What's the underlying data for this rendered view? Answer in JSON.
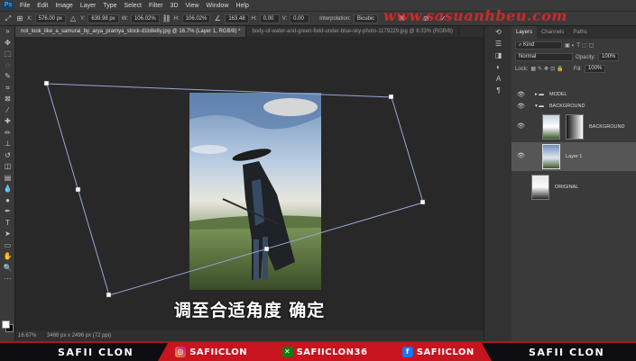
{
  "menu": {
    "logo": "Ps",
    "items": [
      "File",
      "Edit",
      "Image",
      "Layer",
      "Type",
      "Select",
      "Filter",
      "3D",
      "View",
      "Window",
      "Help"
    ]
  },
  "options": {
    "x_label": "X:",
    "x_value": "576.00 px",
    "y_label": "Y:",
    "y_value": "639.98 px",
    "w_label": "W:",
    "w_value": "106.02%",
    "h_label": "H:",
    "h_value": "106.02%",
    "angle_value": "163.48",
    "hskew_label": "H:",
    "hskew_value": "0.00",
    "vskew_label": "V:",
    "vskew_value": "0.00",
    "interp_label": "Interpolation:",
    "interp_value": "Bicubic"
  },
  "watermark": "www.sasuanhbeu.com",
  "tabs": [
    "not_look_like_a_samurai_by_arya_pramya_stock-d1b8e8y.jpg @ 16.7% (Layer 1, RGB/8) *",
    "body-of-water-and-green-field-under-blue-sky-photo-1179229.jpg @ 8.33% (RGB/8)"
  ],
  "status": {
    "zoom": "16.67%",
    "doc": "3468 px x 2496 px (72 ppi)"
  },
  "subtitle": "调至合适角度 确定",
  "panel": {
    "tabs": [
      "Layers",
      "Channels",
      "Paths"
    ],
    "blend_mode": "Normal",
    "opacity_label": "Opacity:",
    "opacity_value": "100%",
    "fill_label": "Fill:",
    "fill_value": "100%",
    "layers": [
      {
        "name": "MODEL",
        "kind": "group"
      },
      {
        "name": "BACKGROUND",
        "kind": "group"
      },
      {
        "name": "BACKGROUND",
        "kind": "layer"
      },
      {
        "name": "Layer 1",
        "kind": "layer",
        "selected": true
      },
      {
        "name": "ORIGINAL",
        "kind": "layer"
      }
    ]
  },
  "banner": {
    "left": "SAFII CLON",
    "right": "SAFII CLON",
    "instagram": "SAFIICLON",
    "xbox": "SAFIICLON36",
    "facebook": "SAFIICLON"
  },
  "colors": {
    "accent_red": "#c8141f",
    "watermark_red": "#e62828",
    "panel_bg": "#3a3a3a"
  }
}
